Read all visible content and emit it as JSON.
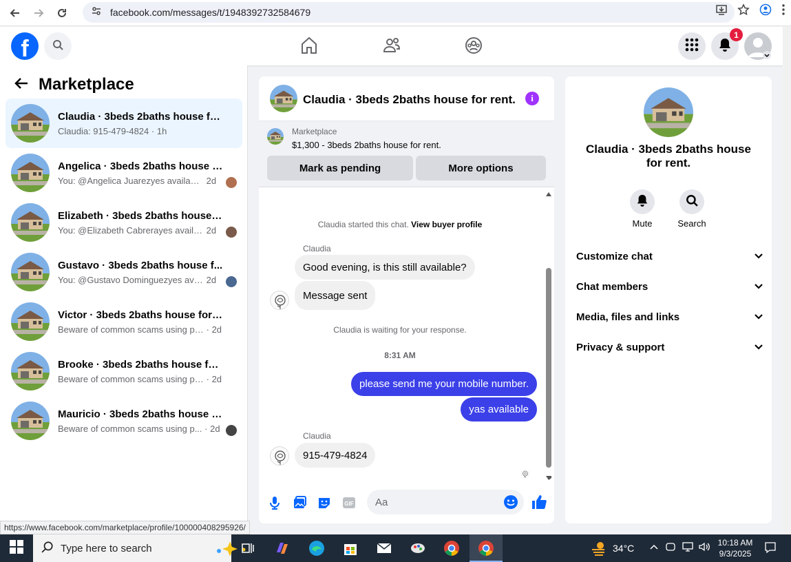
{
  "browser": {
    "url": "facebook.com/messages/t/1948392732584679"
  },
  "header": {
    "logo": "f",
    "notification_count": "1"
  },
  "left": {
    "title": "Marketplace",
    "conversations": [
      {
        "title": "Claudia · 3beds 2baths house for r...",
        "preview": "Claudia: 915-479-4824",
        "time": "· 1h"
      },
      {
        "title": "Angelica · 3beds 2baths house f...",
        "preview": "You: @Angelica Juarezyes available...",
        "time": "2d"
      },
      {
        "title": "Elizabeth · 3beds 2baths house f...",
        "preview": "You: @Elizabeth Cabrerayes availab...",
        "time": "2d"
      },
      {
        "title": "Gustavo · 3beds 2baths house f...",
        "preview": "You: @Gustavo Dominguezyes avai...",
        "time": "2d"
      },
      {
        "title": "Victor · 3beds 2baths house for rent.",
        "preview": "Beware of common scams using pay...",
        "time": "· 2d"
      },
      {
        "title": "Brooke · 3beds 2baths house for r...",
        "preview": "Beware of common scams using pay...",
        "time": "· 2d"
      },
      {
        "title": "Mauricio · 3beds 2baths house f...",
        "preview": "Beware of common scams using p...",
        "time": "· 2d"
      }
    ]
  },
  "chat": {
    "title": "Claudia · 3beds 2baths house for rent.",
    "marketplace_label": "Marketplace",
    "listing": "$1,300 - 3beds 2baths house for rent.",
    "mark_pending": "Mark as pending",
    "more_options": "More options",
    "started_text": "Claudia started this chat.",
    "view_profile": "View buyer profile",
    "sender1": "Claudia",
    "msg1": "Good evening, is this still available?",
    "msg2": "Message sent",
    "waiting": "Claudia is waiting for your response.",
    "timestamp": "8:31 AM",
    "out1": "please send me your mobile number.",
    "out2": "yas available",
    "sender2": "Claudia",
    "msg3": "915-479-4824",
    "input_placeholder": "Aa"
  },
  "details": {
    "title": "Claudia · 3beds 2baths house for rent.",
    "mute": "Mute",
    "search": "Search",
    "sections": [
      "Customize chat",
      "Chat members",
      "Media, files and links",
      "Privacy & support"
    ]
  },
  "status_url": "https://www.facebook.com/marketplace/profile/100000408295926/",
  "taskbar": {
    "search_placeholder": "Type here to search",
    "temperature": "34°C",
    "time": "10:18 AM",
    "date": "9/3/2025"
  },
  "colors": {
    "fb_blue": "#0866ff",
    "outgoing_bubble": "#3b40e8",
    "info_purple": "#a033ff",
    "badge_red": "#e41e3f"
  }
}
